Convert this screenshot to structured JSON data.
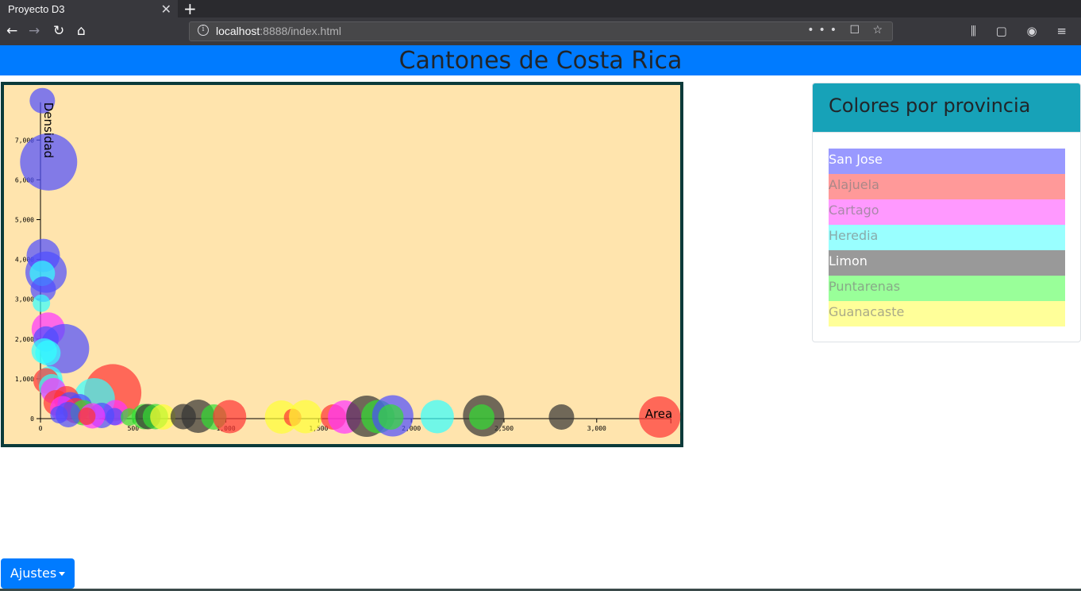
{
  "browser": {
    "tab_title": "Proyecto D3",
    "tab_close": "✕",
    "new_tab": "+",
    "url_host": "localhost",
    "url_rest": ":8888/index.html",
    "url_actions": "••• ☐ ☆",
    "nav_back": "←",
    "nav_forward": "→",
    "nav_reload": "↻",
    "nav_home": "⌂",
    "right_icons": "⫼ ▢ ◉ ≡"
  },
  "header": {
    "title": "Cantones de Costa Rica"
  },
  "legend": {
    "title": "Colores por provincia",
    "items": [
      {
        "label": "San Jose",
        "bg": "#9999ff",
        "fg": "#ffffff"
      },
      {
        "label": "Alajuela",
        "bg": "#ff9999",
        "fg": "#aa8888"
      },
      {
        "label": "Cartago",
        "bg": "#ff99ff",
        "fg": "#aa88aa"
      },
      {
        "label": "Heredia",
        "bg": "#99ffff",
        "fg": "#88aaaa"
      },
      {
        "label": "Limon",
        "bg": "#999999",
        "fg": "#ffffff"
      },
      {
        "label": "Puntarenas",
        "bg": "#99ff99",
        "fg": "#88aa88"
      },
      {
        "label": "Guanacaste",
        "bg": "#ffff99",
        "fg": "#aaaa88"
      }
    ]
  },
  "button": {
    "ajustes": "Ajustes"
  },
  "chart_data": {
    "type": "scatter",
    "xlabel": "Area",
    "ylabel": "Densidad",
    "xlim": [
      0,
      3400
    ],
    "ylim": [
      0,
      7800
    ],
    "xticks": [
      "0",
      "500",
      "1,000",
      "1,500",
      "2,000",
      "2,500",
      "3,000"
    ],
    "yticks": [
      "0",
      "1,000",
      "2,000",
      "3,000",
      "4,000",
      "5,000",
      "6,000",
      "7,000"
    ],
    "colors": {
      "San Jose": "#4d4dff",
      "Alajuela": "#ff3333",
      "Cartago": "#ff33ff",
      "Heredia": "#33ffff",
      "Limon": "#333333",
      "Puntarenas": "#33dd33",
      "Guanacaste": "#ffff33"
    },
    "points": [
      {
        "x": 10,
        "y": 7990,
        "size": 2,
        "prov": "San Jose"
      },
      {
        "x": 44,
        "y": 6450,
        "size": 6,
        "prov": "San Jose"
      },
      {
        "x": 15,
        "y": 4100,
        "size": 3,
        "prov": "San Jose"
      },
      {
        "x": 30,
        "y": 3680,
        "size": 4,
        "prov": "San Jose"
      },
      {
        "x": 10,
        "y": 3650,
        "size": 2,
        "prov": "Heredia"
      },
      {
        "x": 15,
        "y": 3250,
        "size": 2,
        "prov": "San Jose"
      },
      {
        "x": 5,
        "y": 2900,
        "size": 1,
        "prov": "Heredia"
      },
      {
        "x": 42,
        "y": 2250,
        "size": 3,
        "prov": "Cartago"
      },
      {
        "x": 30,
        "y": 2000,
        "size": 2,
        "prov": "San Jose"
      },
      {
        "x": 130,
        "y": 1760,
        "size": 5,
        "prov": "San Jose"
      },
      {
        "x": 20,
        "y": 1700,
        "size": 2,
        "prov": "Heredia"
      },
      {
        "x": 40,
        "y": 1650,
        "size": 2,
        "prov": "Heredia"
      },
      {
        "x": 50,
        "y": 1000,
        "size": 2,
        "prov": "Heredia"
      },
      {
        "x": 30,
        "y": 950,
        "size": 2,
        "prov": "Alajuela"
      },
      {
        "x": 60,
        "y": 800,
        "size": 2,
        "prov": "Heredia"
      },
      {
        "x": 70,
        "y": 700,
        "size": 2,
        "prov": "Cartago"
      },
      {
        "x": 390,
        "y": 650,
        "size": 6,
        "prov": "Alajuela"
      },
      {
        "x": 290,
        "y": 500,
        "size": 4,
        "prov": "Heredia"
      },
      {
        "x": 140,
        "y": 500,
        "size": 2,
        "prov": "Alajuela"
      },
      {
        "x": 85,
        "y": 400,
        "size": 2,
        "prov": "Alajuela"
      },
      {
        "x": 160,
        "y": 350,
        "size": 2,
        "prov": "San Jose"
      },
      {
        "x": 210,
        "y": 300,
        "size": 2,
        "prov": "San Jose"
      },
      {
        "x": 120,
        "y": 250,
        "size": 2,
        "prov": "Cartago"
      },
      {
        "x": 190,
        "y": 200,
        "size": 2,
        "prov": "Alajuela"
      },
      {
        "x": 230,
        "y": 150,
        "size": 2,
        "prov": "Puntarenas"
      },
      {
        "x": 405,
        "y": 150,
        "size": 2,
        "prov": "Cartago"
      },
      {
        "x": 150,
        "y": 100,
        "size": 2,
        "prov": "San Jose"
      },
      {
        "x": 100,
        "y": 100,
        "size": 1,
        "prov": "San Jose"
      },
      {
        "x": 330,
        "y": 80,
        "size": 2,
        "prov": "San Jose"
      },
      {
        "x": 280,
        "y": 70,
        "size": 2,
        "prov": "Cartago"
      },
      {
        "x": 250,
        "y": 60,
        "size": 1,
        "prov": "Alajuela"
      },
      {
        "x": 400,
        "y": 50,
        "size": 1,
        "prov": "San Jose"
      },
      {
        "x": 480,
        "y": 40,
        "size": 1,
        "prov": "Puntarenas"
      },
      {
        "x": 560,
        "y": 50,
        "size": 2,
        "prov": "Puntarenas"
      },
      {
        "x": 580,
        "y": 50,
        "size": 2,
        "prov": "Limon"
      },
      {
        "x": 620,
        "y": 50,
        "size": 2,
        "prov": "Puntarenas"
      },
      {
        "x": 660,
        "y": 40,
        "size": 2,
        "prov": "Guanacaste"
      },
      {
        "x": 770,
        "y": 50,
        "size": 2,
        "prov": "Limon"
      },
      {
        "x": 850,
        "y": 60,
        "size": 3,
        "prov": "Limon"
      },
      {
        "x": 935,
        "y": 40,
        "size": 2,
        "prov": "Puntarenas"
      },
      {
        "x": 1020,
        "y": 50,
        "size": 3,
        "prov": "Alajuela"
      },
      {
        "x": 1300,
        "y": 40,
        "size": 3,
        "prov": "Guanacaste"
      },
      {
        "x": 1360,
        "y": 30,
        "size": 1,
        "prov": "Alajuela"
      },
      {
        "x": 1430,
        "y": 50,
        "size": 3,
        "prov": "Guanacaste"
      },
      {
        "x": 1580,
        "y": 40,
        "size": 2,
        "prov": "Alajuela"
      },
      {
        "x": 1640,
        "y": 40,
        "size": 3,
        "prov": "Cartago"
      },
      {
        "x": 1760,
        "y": 60,
        "size": 4,
        "prov": "Limon"
      },
      {
        "x": 1820,
        "y": 50,
        "size": 3,
        "prov": "Puntarenas"
      },
      {
        "x": 1900,
        "y": 70,
        "size": 4,
        "prov": "San Jose"
      },
      {
        "x": 1890,
        "y": 40,
        "size": 2,
        "prov": "Puntarenas"
      },
      {
        "x": 2140,
        "y": 50,
        "size": 3,
        "prov": "Heredia"
      },
      {
        "x": 2390,
        "y": 70,
        "size": 4,
        "prov": "Limon"
      },
      {
        "x": 2380,
        "y": 40,
        "size": 2,
        "prov": "Puntarenas"
      },
      {
        "x": 2810,
        "y": 40,
        "size": 2,
        "prov": "Limon"
      },
      {
        "x": 3340,
        "y": 40,
        "size": 4,
        "prov": "Alajuela"
      }
    ]
  }
}
